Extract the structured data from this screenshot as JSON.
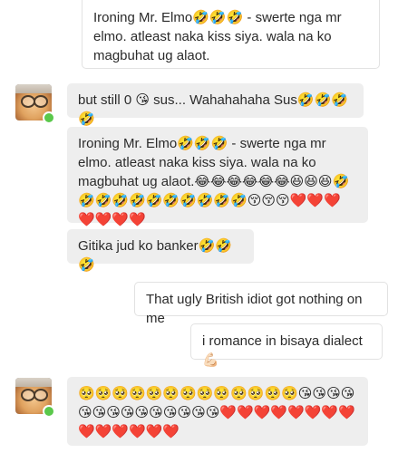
{
  "messages": {
    "m1": "Ironing Mr. Elmo🤣🤣🤣 - swerte nga mr elmo. atleast naka kiss siya. wala na ko magbuhat ug alaot.",
    "m2": "but still 0 😘 sus... Wahahahaha Sus🤣🤣🤣🤣",
    "m3": "Ironing Mr. Elmo🤣🤣🤣 - swerte nga mr elmo. atleast naka kiss siya. wala na ko magbuhat ug alaot.😂😂😂😂😂😂😆😆😆🤣🤣🤣🤣🤣🤣🤣🤣🤣🤣🤣😚😚😚❤️❤️❤️❤️❤️❤️❤️",
    "m4": "Gitika jud ko banker🤣🤣🤣",
    "m5": "That ugly British idiot got nothing on me",
    "m6": "i romance in bisaya dialect 💪🏻",
    "m7": "🥺🥺🥺🥺🥺🥺🥺🥺🥺🥺🥺🥺🥺😘😘😘😘😘😘😘😘😘😘😘😘😘😘❤️❤️❤️❤️❤️❤️❤️❤️❤️❤️❤️❤️❤️❤️"
  },
  "avatars": {
    "status_color": "#5ac84b"
  }
}
